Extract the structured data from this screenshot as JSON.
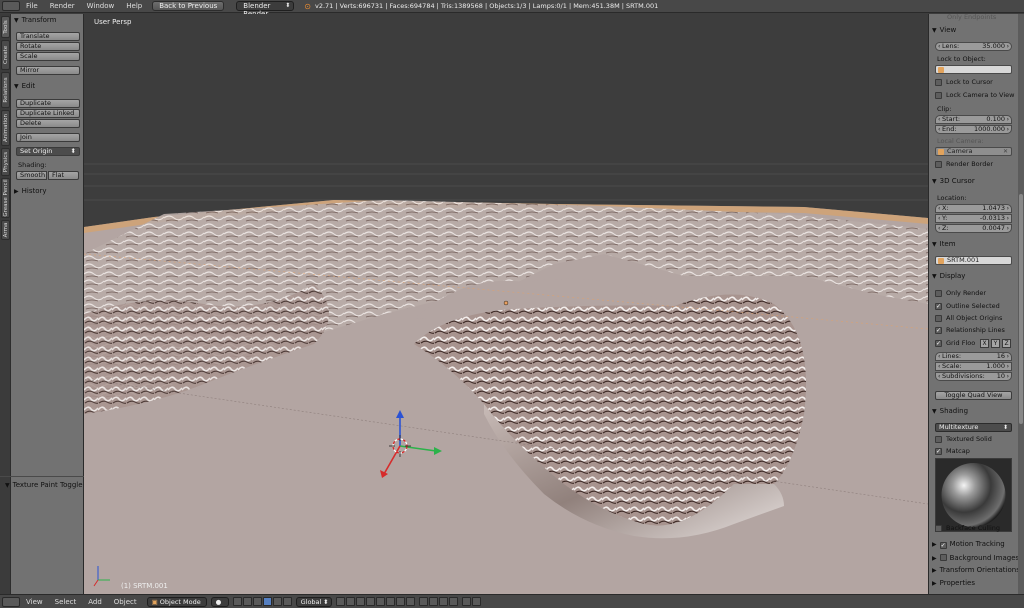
{
  "top_bar": {
    "menus": [
      "File",
      "Render",
      "Window",
      "Help"
    ],
    "back_button": "Back to Previous",
    "render_engine": "Blender Render",
    "stats": "v2.71 | Verts:696731 | Faces:694784 | Tris:1389568 | Objects:1/3 | Lamps:0/1 | Mem:451.38M | SRTM.001"
  },
  "left_tabs": [
    "Tools",
    "Create",
    "Relations",
    "Animation",
    "Physics",
    "Grease Pencil",
    "Arma"
  ],
  "tool_shelf": {
    "transform": {
      "title": "Transform",
      "buttons": [
        "Translate",
        "Rotate",
        "Scale",
        "Mirror"
      ]
    },
    "edit": {
      "title": "Edit",
      "buttons": [
        "Duplicate",
        "Duplicate Linked",
        "Delete",
        "Join"
      ],
      "set_origin": "Set Origin",
      "shading_label": "Shading:",
      "smooth": "Smooth",
      "flat": "Flat"
    },
    "history": "History",
    "texture_paint_toggle": "Texture Paint Toggle"
  },
  "viewport": {
    "view_label": "User Persp",
    "object_label": "(1) SRTM.001",
    "background": "#3d3d3d",
    "terrain_color": "#b3a5a2"
  },
  "properties": {
    "only_endpoints": "Only Endpoints",
    "view": {
      "title": "View",
      "lens_label": "Lens:",
      "lens_value": "35.000",
      "lock_to_object": "Lock to Object:",
      "lock_to_cursor": "Lock to Cursor",
      "lock_camera_to_view": "Lock Camera to View",
      "clip_label": "Clip:",
      "clip_start_label": "Start:",
      "clip_start_value": "0.100",
      "clip_end_label": "End:",
      "clip_end_value": "1000.000",
      "local_camera": "Local Camera:",
      "camera": "Camera",
      "render_border": "Render Border"
    },
    "cursor": {
      "title": "3D Cursor",
      "location": "Location:",
      "x_label": "X:",
      "x_value": "1.0473",
      "y_label": "Y:",
      "y_value": "-0.0313",
      "z_label": "Z:",
      "z_value": "0.0047"
    },
    "item": {
      "title": "Item",
      "name": "SRTM.001"
    },
    "display": {
      "title": "Display",
      "only_render": "Only Render",
      "outline_selected": "Outline Selected",
      "all_object_origins": "All Object Origins",
      "relationship_lines": "Relationship Lines",
      "grid_floor": "Grid Floo",
      "axis_x": "X",
      "axis_y": "Y",
      "axis_z": "Z",
      "lines_label": "Lines:",
      "lines_value": "16",
      "scale_label": "Scale:",
      "scale_value": "1.000",
      "subdivisions_label": "Subdivisions:",
      "subdivisions_value": "10",
      "toggle_quad_view": "Toggle Quad View"
    },
    "shading": {
      "title": "Shading",
      "mode": "Multitexture",
      "textured_solid": "Textured Solid",
      "matcap": "Matcap",
      "backface_culling": "Backface Culling"
    },
    "motion_tracking": "Motion Tracking",
    "background_images": "Background Images",
    "transform_orientations": "Transform Orientations",
    "properties": "Properties"
  },
  "bottom_bar": {
    "menus": [
      "View",
      "Select",
      "Add",
      "Object"
    ],
    "mode": "Object Mode",
    "orientation": "Global"
  }
}
